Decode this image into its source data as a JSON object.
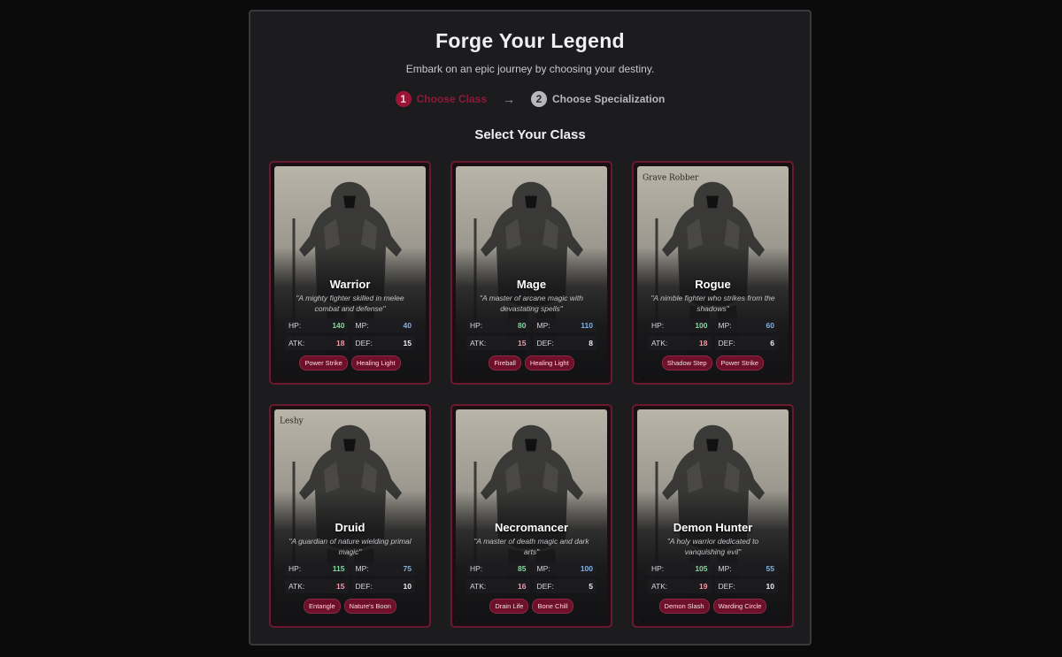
{
  "header": {
    "title": "Forge Your Legend",
    "subtitle": "Embark on an epic journey by choosing your destiny."
  },
  "steps": [
    {
      "number": "1",
      "label": "Choose Class",
      "active": true
    },
    {
      "number": "2",
      "label": "Choose Specialization",
      "active": false
    }
  ],
  "step_arrow": "→",
  "section_title": "Select Your Class",
  "labels": {
    "hp": "HP:",
    "mp": "MP:",
    "atk": "ATK:",
    "def": "DEF:"
  },
  "colors": {
    "accent": "#9b1538",
    "hp": "#86d6a0",
    "mp": "#7fb3e6",
    "atk": "#f19aa8",
    "card_border": "#6a1a30"
  },
  "classes": [
    {
      "name": "Warrior",
      "description": "\"A mighty fighter skilled in melee combat and defense\"",
      "hp": 140,
      "mp": 40,
      "atk": 18,
      "def": 15,
      "skills": [
        "Power Strike",
        "Healing Light"
      ],
      "art_tone": "#b8b4a8"
    },
    {
      "name": "Mage",
      "description": "\"A master of arcane magic with devastating spells\"",
      "hp": 80,
      "mp": 110,
      "atk": 15,
      "def": 8,
      "skills": [
        "Fireball",
        "Healing Light"
      ],
      "art_tone": "#9a9a9c"
    },
    {
      "name": "Rogue",
      "description": "\"A nimble fighter who strikes from the shadows\"",
      "hp": 100,
      "mp": 60,
      "atk": 18,
      "def": 6,
      "skills": [
        "Shadow Step",
        "Power Strike"
      ],
      "art_tone": "#c8c0ae",
      "art_caption": "Grave Robber"
    },
    {
      "name": "Druid",
      "description": "\"A guardian of nature wielding primal magic\"",
      "hp": 115,
      "mp": 75,
      "atk": 15,
      "def": 10,
      "skills": [
        "Entangle",
        "Nature's Boon"
      ],
      "art_tone": "#cfc6b0",
      "art_caption": "Leshy"
    },
    {
      "name": "Necromancer",
      "description": "\"A master of death magic and dark arts\"",
      "hp": 85,
      "mp": 100,
      "atk": 16,
      "def": 5,
      "skills": [
        "Drain Life",
        "Bone Chill"
      ],
      "art_tone": "#a8a49c"
    },
    {
      "name": "Demon Hunter",
      "description": "\"A holy warrior dedicated to vanquishing evil\"",
      "hp": 105,
      "mp": 55,
      "atk": 19,
      "def": 10,
      "skills": [
        "Demon Slash",
        "Warding Circle"
      ],
      "art_tone": "#bdb7a8"
    }
  ]
}
